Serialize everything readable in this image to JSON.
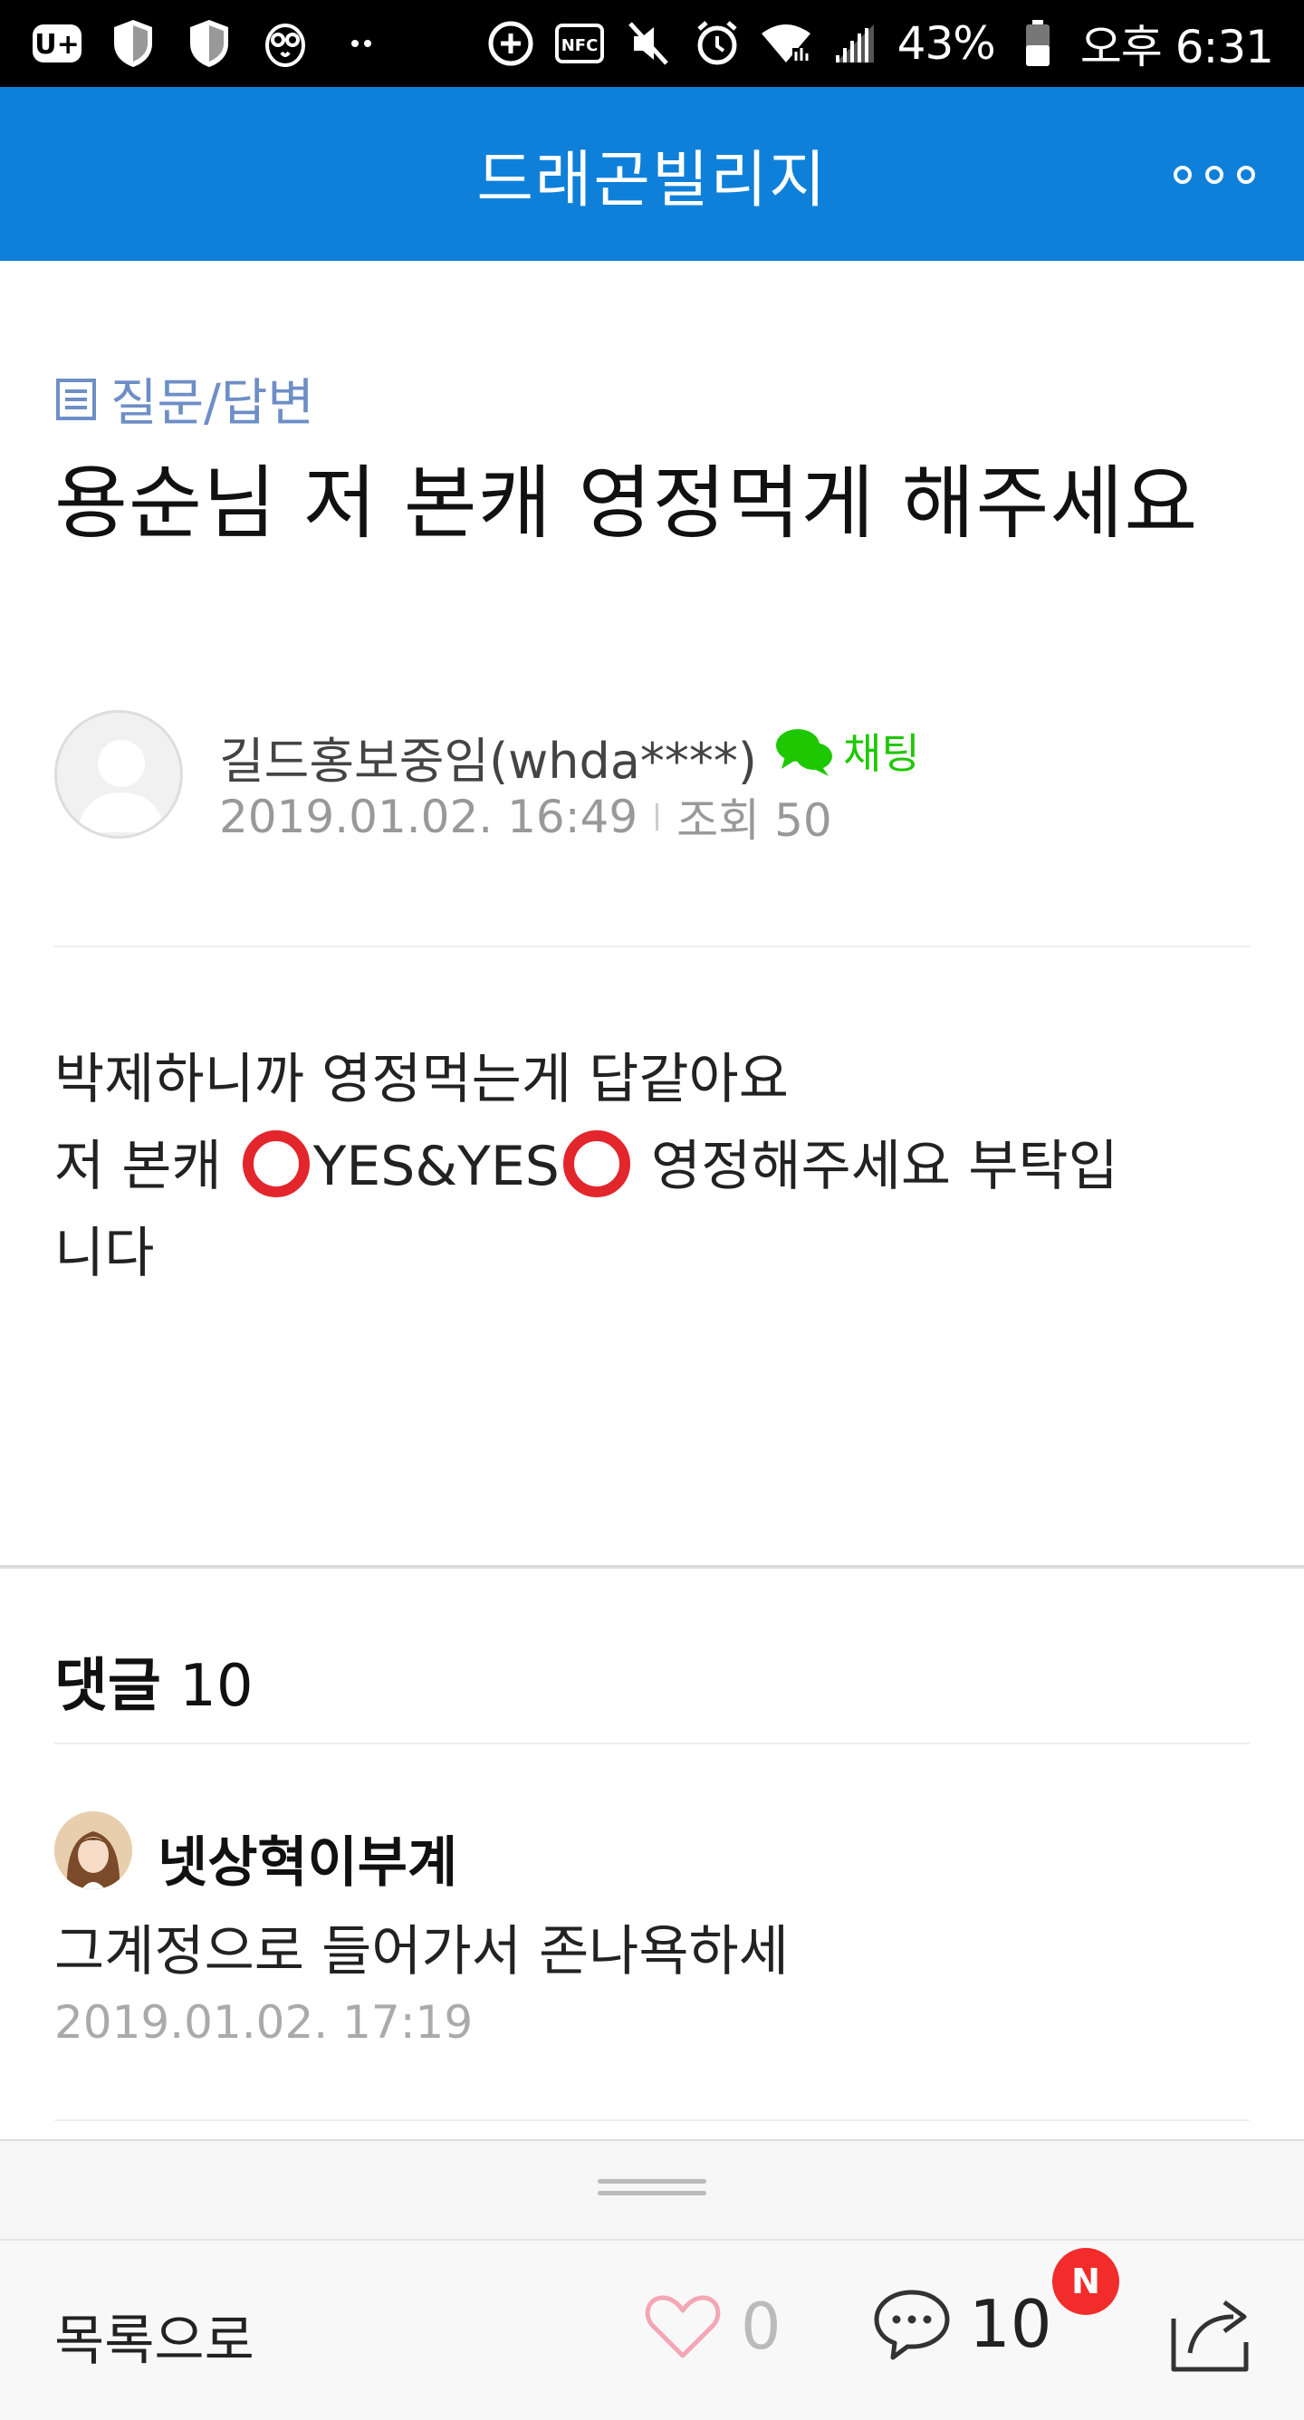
{
  "status_bar": {
    "battery": "43%",
    "time": "오후 6:31",
    "icons": [
      "u-plus-icon",
      "shield-icon",
      "shield-icon",
      "owl-icon",
      "dots-icon",
      "data-saver-icon",
      "nfc-icon",
      "mute-icon",
      "alarm-icon",
      "wifi-icon",
      "signal-icon",
      "battery-icon"
    ],
    "nfc_label": "NFC"
  },
  "header": {
    "title": "드래곤빌리지",
    "more_icon": "more-icon"
  },
  "article": {
    "category": "질문/답변",
    "title": "용순님 저 본캐 영정먹게 해주세요",
    "author": "길드홍보중임(whda****)",
    "chat_label": "채팅",
    "date": "2019.01.02. 16:49",
    "views_label": "조회 50",
    "body_line1": "박제하니까 영정먹는게 답같아요",
    "body_line2_pre": "저 본캐 ",
    "body_line2_mid": "YES&YES",
    "body_line2_post": " 영정해주세요 부탁입",
    "body_line3": "니다"
  },
  "comments": {
    "label": "댓글",
    "count": "10",
    "items": [
      {
        "author": "넷상혁이부계",
        "text": "그계정으로 들어가서 존나욕하세",
        "date": "2019.01.02. 17:19"
      }
    ]
  },
  "bottom_bar": {
    "list_label": "목록으로",
    "like_count": "0",
    "comment_count": "10",
    "new_badge": "N"
  },
  "colors": {
    "header_blue": "#0f80d9",
    "category_blue": "#6e8ec6",
    "chat_green": "#1ec800",
    "badge_red": "#f22b2b",
    "ring_red": "#e3262c"
  }
}
